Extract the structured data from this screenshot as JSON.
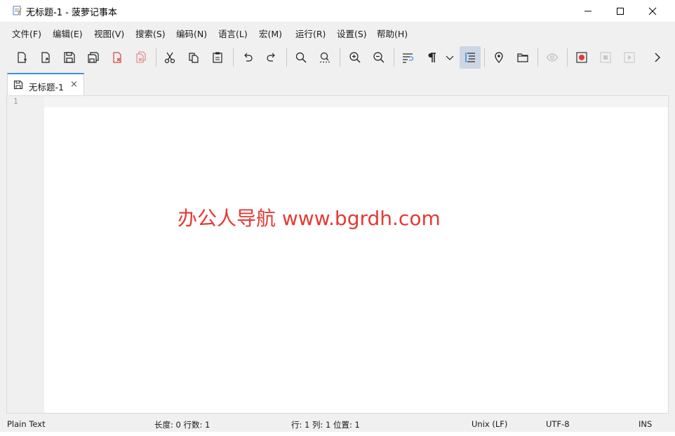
{
  "window": {
    "title": "无标题-1 - 菠萝记事本",
    "controls": {
      "minimize": "minimize-icon",
      "maximize": "maximize-icon",
      "close": "close-icon"
    }
  },
  "menu": [
    "文件(F)",
    "编辑(E)",
    "视图(V)",
    "搜索(S)",
    "编码(N)",
    "语言(L)",
    "宏(M)",
    "运行(R)",
    "设置(S)",
    "帮助(H)"
  ],
  "toolbar": {
    "icons": [
      "new-file-icon",
      "open-file-icon",
      "save-icon",
      "save-all-icon",
      "close-file-icon",
      "close-all-icon",
      "cut-icon",
      "copy-icon",
      "paste-icon",
      "undo-icon",
      "redo-icon",
      "find-icon",
      "find-replace-icon",
      "zoom-in-icon",
      "zoom-out-icon",
      "word-wrap-icon",
      "show-symbols-icon",
      "dropdown-chevron-icon",
      "indent-guide-icon",
      "bookmark-pin-icon",
      "folder-icon",
      "preview-eye-icon",
      "record-macro-icon",
      "stop-record-icon",
      "play-macro-icon",
      "more-chevron-icon"
    ],
    "active": "indent-guide-icon"
  },
  "tabs": [
    {
      "label": "无标题-1",
      "icon": "save-icon",
      "close": "×"
    }
  ],
  "editor": {
    "line_numbers": [
      "1"
    ],
    "content": ""
  },
  "watermark": "办公人导航 www.bgrdh.com",
  "status": {
    "language": "Plain Text",
    "length_lines": "长度: 0  行数: 1",
    "position": "行: 1  列: 1  位置: 1",
    "eol": "Unix (LF)",
    "encoding": "UTF-8",
    "mode": "INS"
  },
  "colors": {
    "accent": "#3d8fe0",
    "watermark": "#e53935",
    "record": "#e53935"
  }
}
